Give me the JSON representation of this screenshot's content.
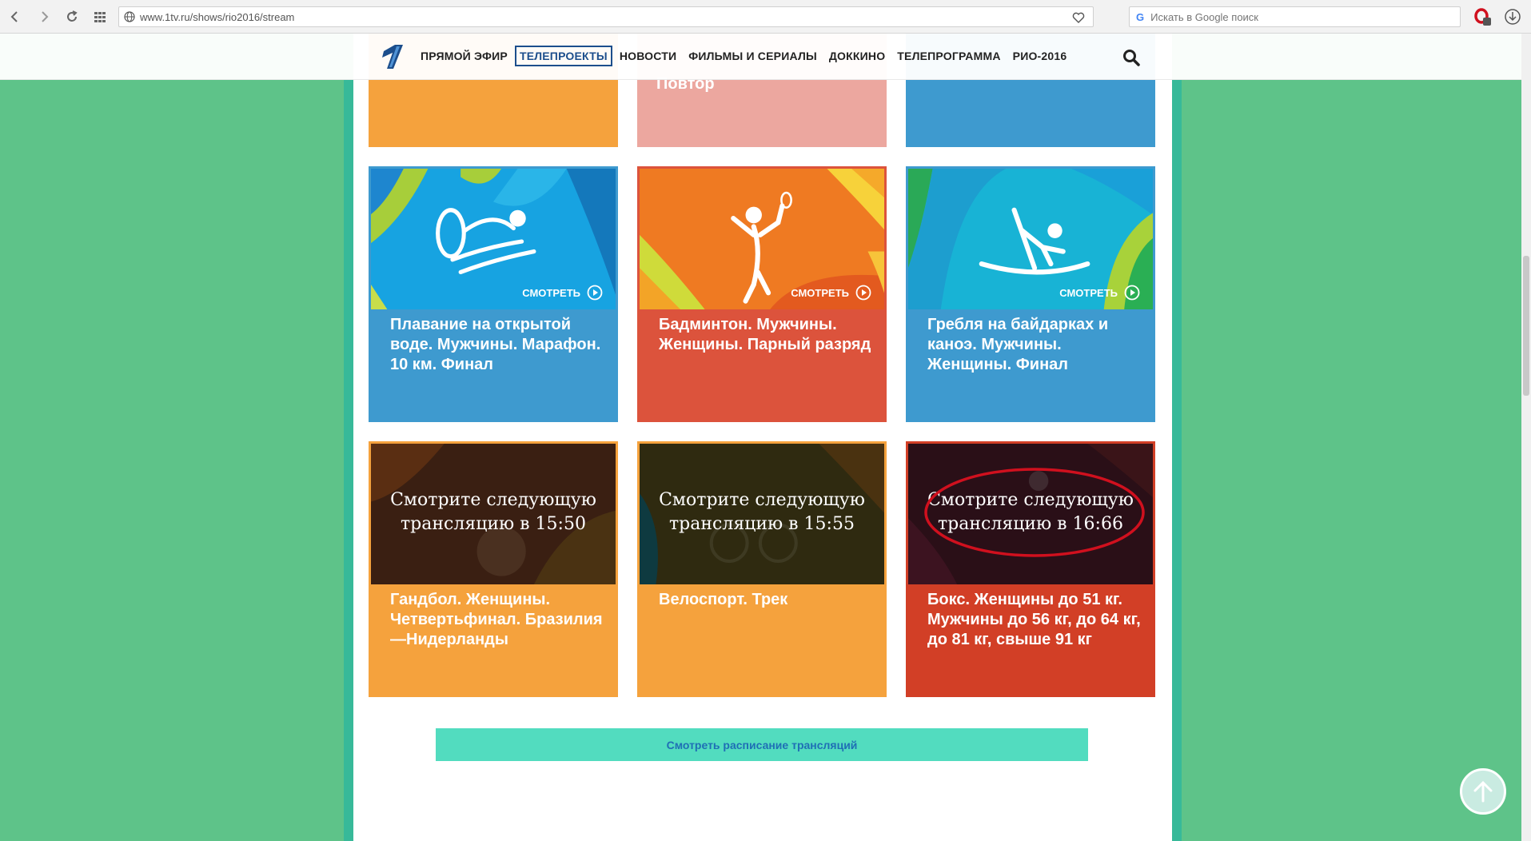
{
  "browser": {
    "url": "www.1tv.ru/shows/rio2016/stream",
    "search_placeholder": "Искать в Google поиск",
    "search_engine_letter": "G"
  },
  "site": {
    "nav": [
      {
        "label": "ПРЯМОЙ ЭФИР"
      },
      {
        "label": "ТЕЛЕПРОЕКТЫ"
      },
      {
        "label": "НОВОСТИ"
      },
      {
        "label": "ФИЛЬМЫ И СЕРИАЛЫ"
      },
      {
        "label": "ДОККИНО"
      },
      {
        "label": "ТЕЛЕПРОГРАММА"
      },
      {
        "label": "РИО-2016"
      }
    ],
    "active_nav": "ТЕЛЕПРОЕКТЫ"
  },
  "cards_top": [
    {
      "title": "",
      "color": "#f5a23d"
    },
    {
      "title": "Повтор",
      "color": "#eca79f"
    },
    {
      "title": "",
      "color": "#3e9acf"
    }
  ],
  "cards_mid": [
    {
      "title": "Плавание на открытой воде. Мужчины. Марафон. 10 км. Финал",
      "watch": "СМОТРЕТЬ",
      "sport_icon": "swimming-pictogram"
    },
    {
      "title": "Бадминтон. Мужчины. Женщины. Парный разряд",
      "watch": "СМОТРЕТЬ",
      "sport_icon": "badminton-pictogram"
    },
    {
      "title": "Гребля на байдарках и каноэ. Мужчины. Женщины. Финал",
      "watch": "СМОТРЕТЬ",
      "sport_icon": "canoe-pictogram"
    }
  ],
  "cards_bottom": [
    {
      "title": "Гандбол. Женщины. Четвертьфинал. Бразилия—Нидерланды",
      "next_line1": "Смотрите следующую",
      "next_line2": "трансляцию в 15:50"
    },
    {
      "title": "Велоспорт. Трек",
      "next_line1": "Смотрите следующую",
      "next_line2": "трансляцию в 15:55"
    },
    {
      "title": "Бокс. Женщины до 51 кг. Мужчины до 56 кг, до 64 кг, до 81 кг, свыше 91 кг",
      "next_line1": "Смотрите следующую",
      "next_line2": "трансляцию в 16:66"
    }
  ],
  "schedule_button": "Смотреть расписание трансляций",
  "colors": {
    "background_green": "#5ec389",
    "stripe_teal": "#37b999",
    "blue_card": "#3e9acf",
    "red_card": "#dc533c",
    "orange_card": "#f5a23d",
    "boxing_card": "#d23f26",
    "schedule_button": "#52dcbf",
    "annotation_red": "#d0101e"
  }
}
